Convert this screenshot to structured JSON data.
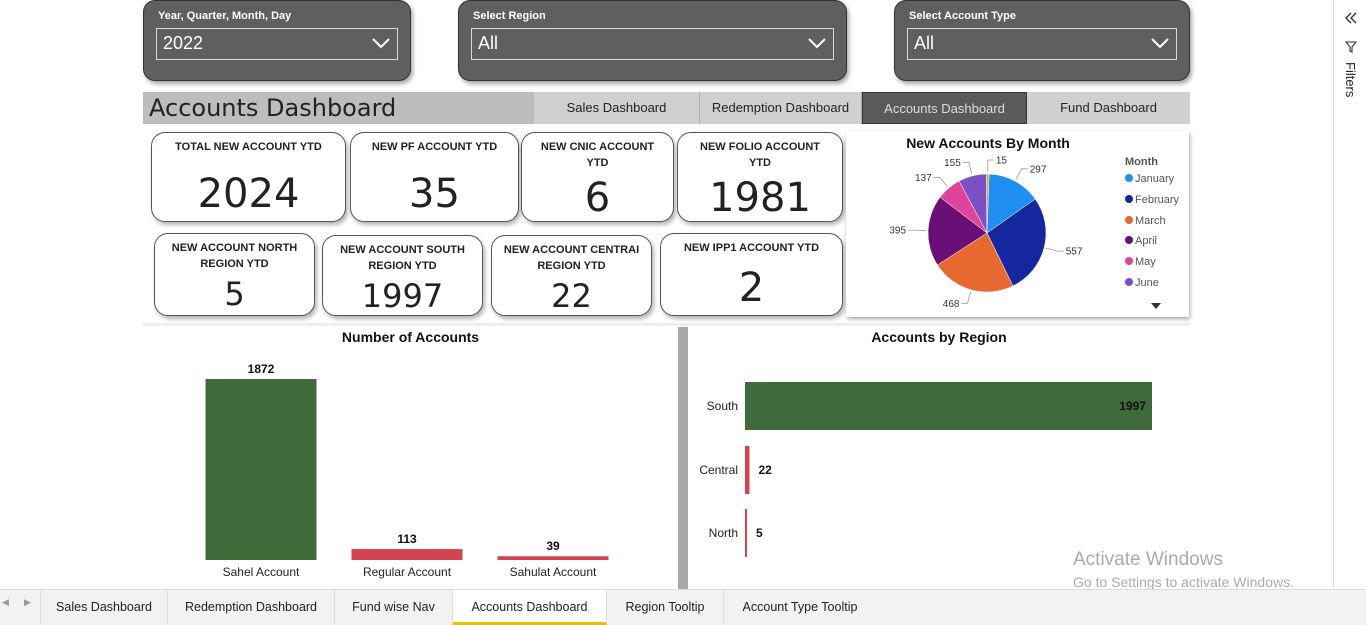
{
  "slicers": [
    {
      "title": "Year, Quarter, Month, Day",
      "value": "2022"
    },
    {
      "title": "Select Region",
      "value": "All"
    },
    {
      "title": "Select Account Type",
      "value": "All"
    }
  ],
  "header": {
    "title": "Accounts Dashboard",
    "nav": [
      "Sales Dashboard",
      "Redemption Dashboard",
      "Accounts Dashboard",
      "Fund Dashboard"
    ]
  },
  "cards": [
    {
      "title": "TOTAL NEW ACCOUNT YTD",
      "value": "2024"
    },
    {
      "title": "NEW PF ACCOUNT YTD",
      "value": "35"
    },
    {
      "title": "NEW CNIC ACCOUNT YTD",
      "value": "6"
    },
    {
      "title": "NEW FOLIO ACCOUNT YTD",
      "value": "1981"
    },
    {
      "title": "NEW ACCOUNT NORTH REGION YTD",
      "value": "5"
    },
    {
      "title": "NEW ACCOUNT SOUTH REGION YTD",
      "value": "1997"
    },
    {
      "title": "NEW ACCOUNT CENTRAI REGION YTD",
      "value": "22"
    },
    {
      "title": "NEW IPP1 ACCOUNT YTD",
      "value": "2"
    }
  ],
  "colors": {
    "green": "#3f6b3a",
    "red": "#d1444f",
    "january": "#1f8ef1",
    "february": "#15279e",
    "march": "#e8692f",
    "april": "#6a0f77",
    "may": "#e0449a",
    "june": "#7c4fc4",
    "other": "#d4a53a"
  },
  "chart_data": [
    {
      "type": "pie",
      "title": "New Accounts By Month",
      "legend_title": "Month",
      "legend_position": "right",
      "categories": [
        "January",
        "February",
        "March",
        "April",
        "May",
        "June",
        ""
      ],
      "values": [
        297,
        557,
        468,
        395,
        137,
        155,
        15
      ]
    },
    {
      "type": "bar",
      "title": "Number of Accounts",
      "categories": [
        "Sahel Account",
        "Regular Account",
        "Sahulat Account"
      ],
      "values": [
        1872,
        113,
        39
      ]
    },
    {
      "type": "bar",
      "orientation": "horizontal",
      "title": "Accounts by Region",
      "categories": [
        "South",
        "Central",
        "North"
      ],
      "values": [
        1997,
        22,
        5
      ]
    }
  ],
  "right_pane": {
    "label": "Filters",
    "collapse_icon": "double-chevron-left-icon",
    "filter_icon": "funnel-icon"
  },
  "watermark": {
    "line1": "Activate Windows",
    "line2": "Go to Settings to activate Windows."
  },
  "tabs": [
    "Sales Dashboard",
    "Redemption Dashboard",
    "Fund wise Nav",
    "Accounts Dashboard",
    "Region Tooltip",
    "Account Type Tooltip"
  ],
  "active_tab": "Accounts Dashboard"
}
